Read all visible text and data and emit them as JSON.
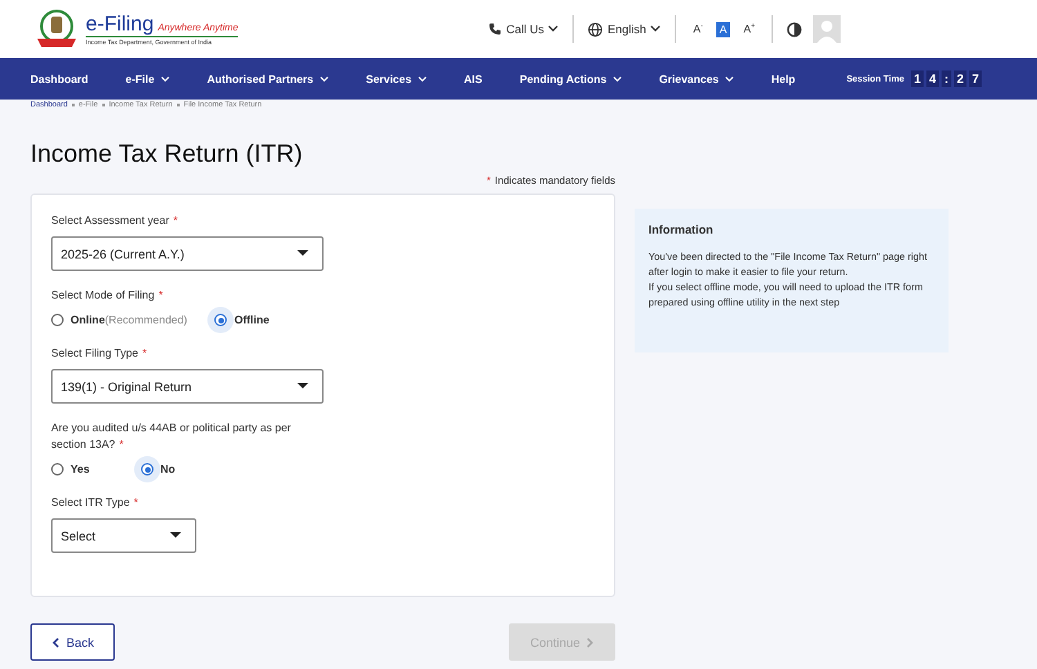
{
  "header": {
    "brand": "e-Filing",
    "tagline": "Anywhere Anytime",
    "subtitle": "Income Tax Department, Government of India",
    "call_us": "Call Us",
    "language": "English",
    "font_sizes": [
      {
        "label": "A",
        "sup": "-",
        "selected": false
      },
      {
        "label": "A",
        "selected": true
      },
      {
        "label": "A",
        "sup": "+",
        "selected": false
      }
    ]
  },
  "nav": {
    "items": [
      {
        "label": "Dashboard",
        "dropdown": false
      },
      {
        "label": "e-File",
        "dropdown": true
      },
      {
        "label": "Authorised Partners",
        "dropdown": true
      },
      {
        "label": "Services",
        "dropdown": true
      },
      {
        "label": "AIS",
        "dropdown": false
      },
      {
        "label": "Pending Actions",
        "dropdown": true
      },
      {
        "label": "Grievances",
        "dropdown": true
      },
      {
        "label": "Help",
        "dropdown": false
      }
    ],
    "session_label": "Session Time",
    "session_digits": [
      "1",
      "4",
      ":",
      "2",
      "7"
    ]
  },
  "breadcrumb": [
    "Dashboard",
    "e-File",
    "Income Tax Return",
    "File Income Tax Return"
  ],
  "title": "Income Tax Return (ITR)",
  "mandatory_note": {
    "mark": "*",
    "text": "Indicates mandatory fields"
  },
  "form": [
    {
      "kind": "select",
      "label": "Select Assessment year",
      "mark": "*",
      "value": "2025-26  (Current A.Y.)",
      "wide": true
    },
    {
      "kind": "radio",
      "label": "Select Mode of Filing",
      "mark": "*",
      "options": [
        {
          "label": "Online",
          "hint": "(Recommended)",
          "selected": false
        },
        {
          "label": "Offline",
          "selected": true
        }
      ]
    },
    {
      "kind": "select",
      "label": "Select Filing Type",
      "mark": "*",
      "value": "139(1) - Original Return",
      "wide": true
    },
    {
      "kind": "radio",
      "label": "Are you audited u/s 44AB or political party as per section 13A?",
      "mark": "*",
      "options": [
        {
          "label": "Yes",
          "selected": false
        },
        {
          "label": "No",
          "selected": true
        }
      ]
    },
    {
      "kind": "select",
      "label": "Select ITR Type",
      "mark": "*",
      "value": "Select",
      "wide": false
    }
  ],
  "info": {
    "title": "Information",
    "text": "You've been directed to the \"File Income Tax Return\" page right after login to make it easier to file your return.\nIf you select offline mode, you will need to upload the ITR form prepared using offline utility in the next step"
  },
  "back_button": "Back",
  "continue_button": {
    "label": "Continue",
    "disabled": true
  }
}
